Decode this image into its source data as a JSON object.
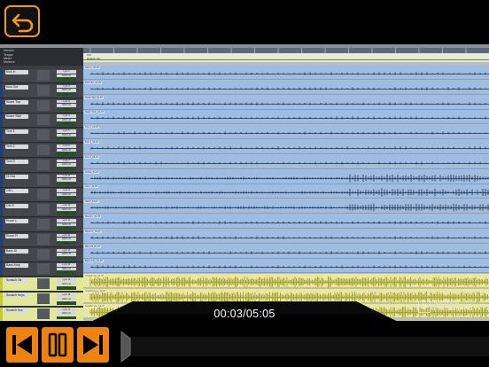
{
  "app": {
    "back_icon": "undo-arrow-icon",
    "accent": "#f0820f"
  },
  "session": {
    "header_left": "Version",
    "header_rows": [
      "Tempo",
      "Meter",
      "Markers"
    ],
    "tempo_label": "120",
    "tempo_value": "Default: 90",
    "tracks": [
      {
        "name": "Kick In",
        "io_a": "Lyric 1",
        "io_b": "MOK LR",
        "vol": "0.0",
        "clip": "Kick In_01-07",
        "selected": false
      },
      {
        "name": "Kick Out",
        "io_a": "Lyric 2",
        "io_b": "MOK LR",
        "vol": "0.0",
        "clip": "Kick Out_01-01",
        "selected": false
      },
      {
        "name": "Snare Top",
        "io_a": "Lyric 3",
        "io_b": "MOK LR",
        "vol": "0.0",
        "clip": "Snare Top_01-07",
        "selected": false
      },
      {
        "name": "Snare Side",
        "io_a": "Lyric 4",
        "io_b": "MOK LR",
        "vol": "0.0",
        "clip": "Snare Side_01-07",
        "selected": false
      },
      {
        "name": "Tom 1",
        "io_a": "Lyric 5",
        "io_b": "MOK LR",
        "vol": "0.0",
        "clip": "Tom 1_01-07",
        "selected": false
      },
      {
        "name": "Tom 2",
        "io_a": "Lyric 6",
        "io_b": "MOK LR",
        "vol": "0.0",
        "clip": "Tom 2_01-07",
        "selected": false
      },
      {
        "name": "Tom 3",
        "io_a": "Lyric 7",
        "io_b": "MOK LR",
        "vol": "0.0",
        "clip": "Tom 3_01-07",
        "selected": false
      },
      {
        "name": "HI Hat",
        "io_a": "Lyric 8",
        "io_b": "MOK LR",
        "vol": "0.0",
        "clip": "HI Hat_01-07",
        "selected": false
      },
      {
        "name": "OH L",
        "io_a": "Lyric 9",
        "io_b": "MOK LR",
        "vol": "0.0",
        "clip": "OH L_01-07",
        "selected": false
      },
      {
        "name": "OH R",
        "io_a": "Lyric 10",
        "io_b": "MOK LR",
        "vol": "0.0",
        "clip": "OH R_01-07",
        "selected": false
      },
      {
        "name": "Room L",
        "io_a": "Lyric 11",
        "io_b": "MOK LR",
        "vol": "0.0",
        "clip": "Room L_01-07",
        "selected": false
      },
      {
        "name": "Room R",
        "io_a": "Lyric 12",
        "io_b": "MOK LR",
        "vol": "0.0",
        "clip": "Room R_01-07",
        "selected": false
      },
      {
        "name": "Bass DI",
        "io_a": "Lyric 13",
        "io_b": "MOK LR",
        "vol": "0.0",
        "clip": "Bass DI_01-07",
        "selected": false
      },
      {
        "name": "Bass Amp",
        "io_a": "Lyric 14",
        "io_b": "MOK LR",
        "vol": "0.0",
        "clip": "Bass Amp_01-07",
        "selected": false
      },
      {
        "name": "Scratch Gtr",
        "io_a": "Lyric 15",
        "io_b": "MOK LR",
        "vol": "0.0",
        "clip": "Scratch Gtr_01-07",
        "selected": true
      },
      {
        "name": "Scratch Keys",
        "io_a": "Lyric 16",
        "io_b": "MOK LR",
        "vol": "0.0",
        "clip": "Scratch Keys_01-07",
        "selected": true
      },
      {
        "name": "Scratch Vox",
        "io_a": "Lyric 17",
        "io_b": "MOK LR",
        "vol": "0.0",
        "clip": "Scratch Vox_01-07",
        "selected": true
      }
    ]
  },
  "watermark": {
    "logo_letter": "N",
    "line1": "Nonlinear",
    "line2": "Educating Inc."
  },
  "player": {
    "current_time": "00:03",
    "total_time": "05:05",
    "time_display": "00:03/05:05",
    "progress": 0.0098,
    "prev_icon": "skip-previous-icon",
    "pause_icon": "pause-icon",
    "next_icon": "skip-next-icon"
  }
}
